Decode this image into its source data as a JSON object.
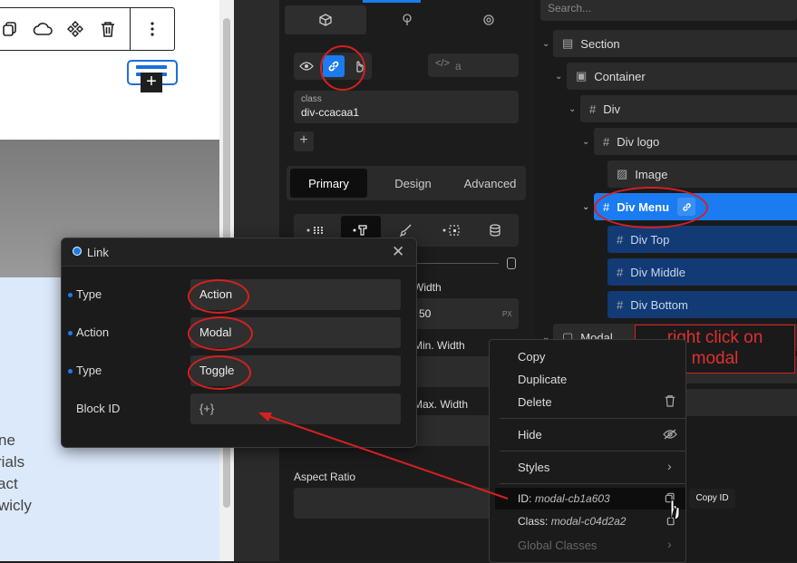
{
  "canvas": {
    "body_lines": [
      "ne",
      "rials",
      "act",
      "wicly"
    ]
  },
  "settings": {
    "link_placeholder": "a",
    "class_label": "class",
    "class_value": "div-ccacaa1",
    "add_label": "+",
    "tabs": [
      "Primary",
      "Design",
      "Advanced"
    ],
    "width_label": "Width",
    "width_value": "50",
    "width_unit": "PX",
    "min_width_label": "Min. Width",
    "max_width_label": "Max. Width",
    "aspect_ratio_label": "Aspect Ratio"
  },
  "navigator": {
    "search_placeholder": "Search...",
    "nodes": [
      "Section",
      "Container",
      "Div",
      "Div logo",
      "Image",
      "Div Menu",
      "Div Top",
      "Div Middle",
      "Div Bottom",
      "Modal"
    ]
  },
  "link_modal": {
    "title": "Link",
    "rows": [
      {
        "label": "Type",
        "value": "Action"
      },
      {
        "label": "Action",
        "value": "Modal"
      },
      {
        "label": "Type",
        "value": "Toggle"
      },
      {
        "label": "Block ID",
        "value": "{+}"
      }
    ]
  },
  "context_menu": {
    "items": [
      "Copy",
      "Duplicate",
      "Delete",
      "Hide",
      "Styles"
    ],
    "id_label": "ID:",
    "id_value": "modal-cb1a603",
    "class_label": "Class:",
    "class_value": "modal-c04d2a2",
    "global_classes": "Global Classes",
    "tooltip": "Copy ID"
  },
  "annotation": {
    "line1": "right click on",
    "line2": "modal"
  },
  "colors": {
    "accent": "#1a7cf0",
    "annotation": "#d62020"
  }
}
